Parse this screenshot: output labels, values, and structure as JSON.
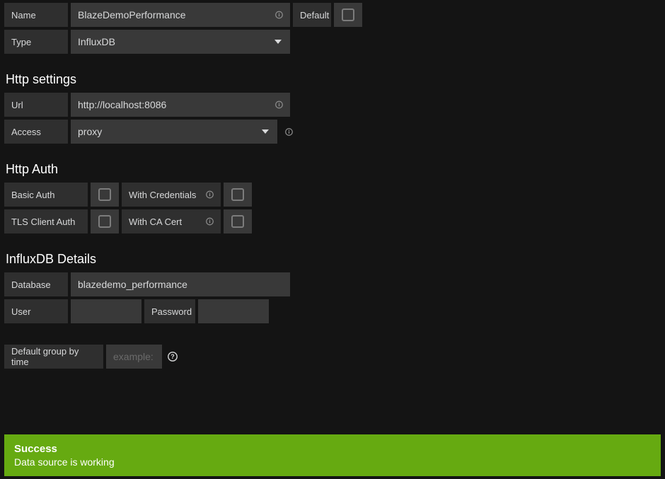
{
  "top": {
    "name_label": "Name",
    "name_value": "BlazeDemoPerformance",
    "default_label": "Default",
    "type_label": "Type",
    "type_value": "InfluxDB"
  },
  "http_settings": {
    "heading": "Http settings",
    "url_label": "Url",
    "url_value": "http://localhost:8086",
    "access_label": "Access",
    "access_value": "proxy"
  },
  "http_auth": {
    "heading": "Http Auth",
    "basic_auth_label": "Basic Auth",
    "with_credentials_label": "With Credentials",
    "tls_client_auth_label": "TLS Client Auth",
    "with_ca_cert_label": "With CA Cert"
  },
  "influx": {
    "heading": "InfluxDB Details",
    "database_label": "Database",
    "database_value": "blazedemo_performance",
    "user_label": "User",
    "user_value": "",
    "password_label": "Password",
    "password_value": ""
  },
  "groupby": {
    "label": "Default group by time",
    "placeholder": "example:"
  },
  "alert": {
    "title": "Success",
    "body": "Data source is working"
  }
}
